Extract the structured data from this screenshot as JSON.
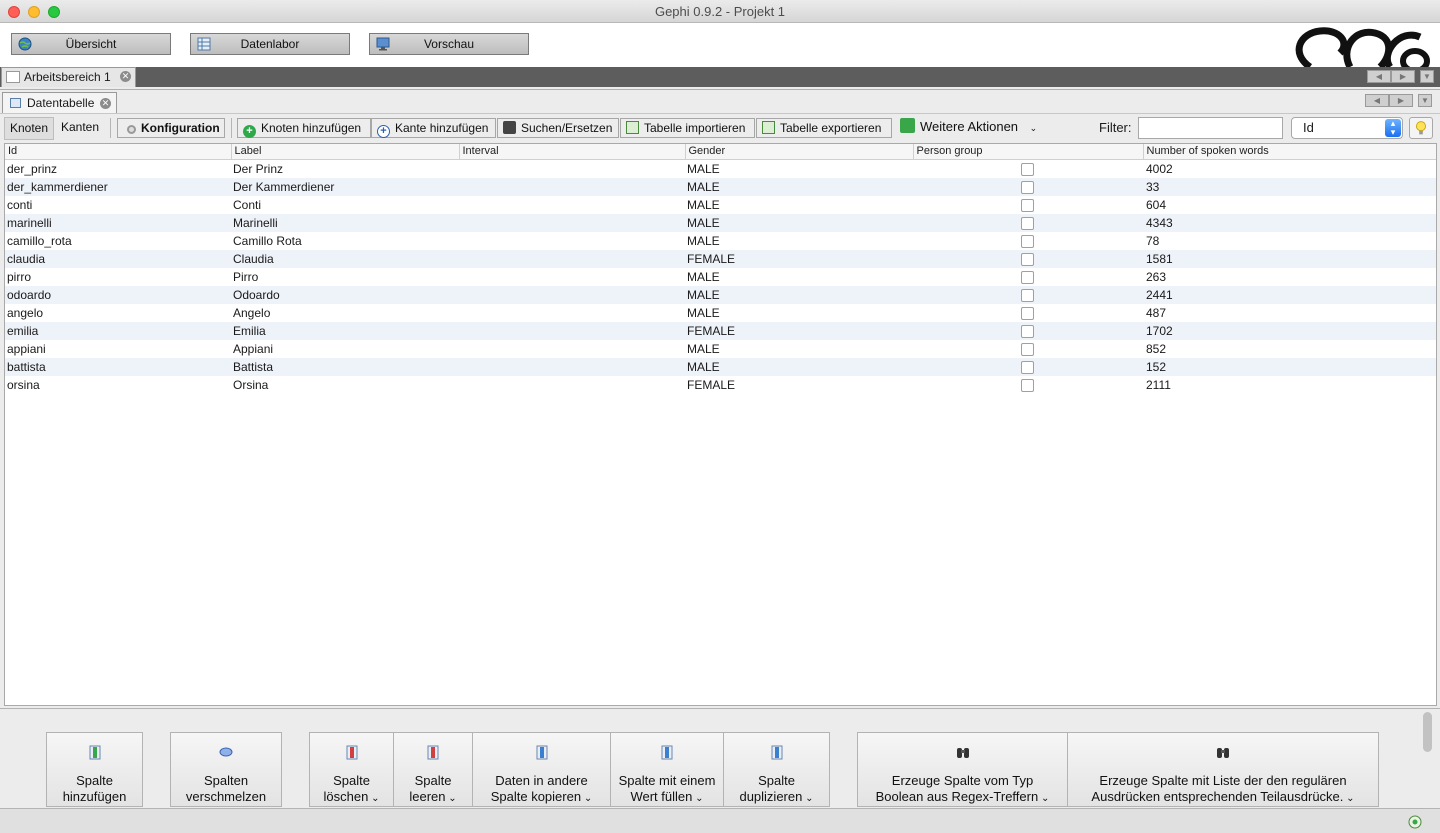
{
  "window": {
    "title": "Gephi 0.9.2 - Projekt 1"
  },
  "modes": [
    {
      "label": "Übersicht"
    },
    {
      "label": "Datenlabor"
    },
    {
      "label": "Vorschau"
    }
  ],
  "workspace": {
    "tab_label": "Arbeitsbereich 1"
  },
  "panel": {
    "tab_label": "Datentabelle"
  },
  "toolbar": {
    "nodes_tab": "Knoten",
    "edges_tab": "Kanten",
    "config": "Konfiguration",
    "add_node": "Knoten hinzufügen",
    "add_edge": "Kante hinzufügen",
    "search_replace": "Suchen/Ersetzen",
    "import_table": "Tabelle importieren",
    "export_table": "Tabelle exportieren",
    "more_actions": "Weitere Aktionen",
    "filter_label": "Filter:",
    "filter_value": "",
    "column_select": "Id"
  },
  "table": {
    "headers": [
      "Id",
      "Label",
      "Interval",
      "Gender",
      "Person group",
      "Number of spoken words"
    ],
    "rows": [
      [
        "der_prinz",
        "Der Prinz",
        "",
        "MALE",
        false,
        "4002"
      ],
      [
        "der_kammerdiener",
        "Der Kammerdiener",
        "",
        "MALE",
        false,
        "33"
      ],
      [
        "conti",
        "Conti",
        "",
        "MALE",
        false,
        "604"
      ],
      [
        "marinelli",
        "Marinelli",
        "",
        "MALE",
        false,
        "4343"
      ],
      [
        "camillo_rota",
        "Camillo Rota",
        "",
        "MALE",
        false,
        "78"
      ],
      [
        "claudia",
        "Claudia",
        "",
        "FEMALE",
        false,
        "1581"
      ],
      [
        "pirro",
        "Pirro",
        "",
        "MALE",
        false,
        "263"
      ],
      [
        "odoardo",
        "Odoardo",
        "",
        "MALE",
        false,
        "2441"
      ],
      [
        "angelo",
        "Angelo",
        "",
        "MALE",
        false,
        "487"
      ],
      [
        "emilia",
        "Emilia",
        "",
        "FEMALE",
        false,
        "1702"
      ],
      [
        "appiani",
        "Appiani",
        "",
        "MALE",
        false,
        "852"
      ],
      [
        "battista",
        "Battista",
        "",
        "MALE",
        false,
        "152"
      ],
      [
        "orsina",
        "Orsina",
        "",
        "FEMALE",
        false,
        "2111"
      ]
    ]
  },
  "actions": [
    {
      "line1": "Spalte",
      "line2": "hinzufügen",
      "dropdown": false
    },
    {
      "line1": "Spalten",
      "line2": "verschmelzen",
      "dropdown": false
    },
    {
      "line1": "Spalte",
      "line2": "löschen",
      "dropdown": true
    },
    {
      "line1": "Spalte",
      "line2": "leeren",
      "dropdown": true
    },
    {
      "line1": "Daten in andere",
      "line2": "Spalte kopieren",
      "dropdown": true
    },
    {
      "line1": "Spalte mit einem",
      "line2": "Wert füllen",
      "dropdown": true
    },
    {
      "line1": "Spalte",
      "line2": "duplizieren",
      "dropdown": true
    },
    {
      "line1": "Erzeuge Spalte vom Typ",
      "line2": "Boolean aus Regex-Treffern",
      "dropdown": true
    },
    {
      "line1": "Erzeuge Spalte mit Liste der den regulären",
      "line2": "Ausdrücken entsprechenden Teilausdrücke.",
      "dropdown": true
    }
  ]
}
